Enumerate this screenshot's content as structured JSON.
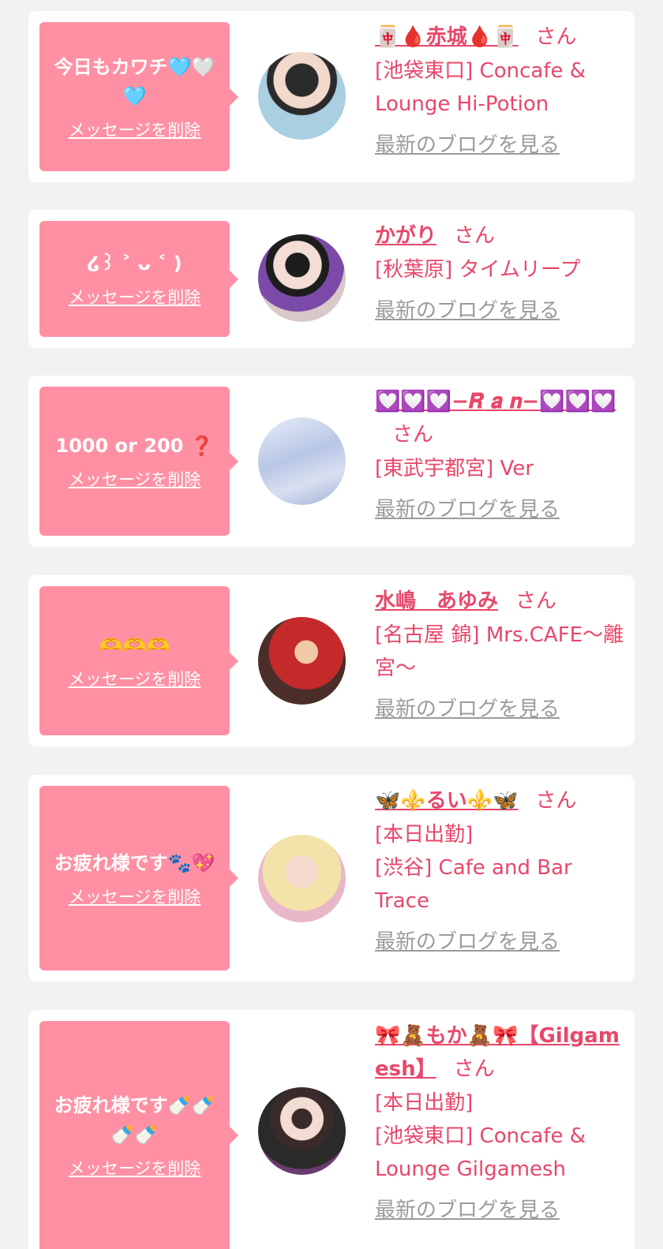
{
  "delete_label": "メッセージを削除",
  "blog_label": "最新のブログを見る",
  "san": "さん",
  "colors": {
    "accent": "#e8476a",
    "bubble": "#ff90a3",
    "muted": "#9b9b9b",
    "background": "#f2f2f2"
  },
  "cards": [
    {
      "message": "今日もカワチ🩵🤍🩵",
      "name": "🀄🩸赤城🩸🀄",
      "shop": "[池袋東口] Concafe & Lounge Hi-Potion"
    },
    {
      "message": "໒꒱ ˃ ᴗ ˂ )",
      "name": "かがり",
      "shop": "[秋葉原] タイムリープ"
    },
    {
      "message": "1000 or 200 ❓",
      "name": "💟💟💟−𝑹 𝒂 𝒏−💟💟💟",
      "shop": "[東武宇都宮] Ver"
    },
    {
      "message": "🫶🫶🫶",
      "name": "水嶋　あゆみ",
      "shop": "[名古屋 錦] Mrs.CAFE〜離宮〜"
    },
    {
      "message": "お疲れ様です🐾💖",
      "name": "🦋⚜️るい⚜️🦋",
      "shop": "[本日出勤]\n[渋谷] Cafe and Bar Trace"
    },
    {
      "message": "お疲れ様です🍼🍼🍼🍼",
      "name": "🎀🧸もか🧸🎀【Gilgamesh】",
      "shop": "[本日出勤]\n[池袋東口] Concafe & Lounge Gilgamesh"
    }
  ]
}
